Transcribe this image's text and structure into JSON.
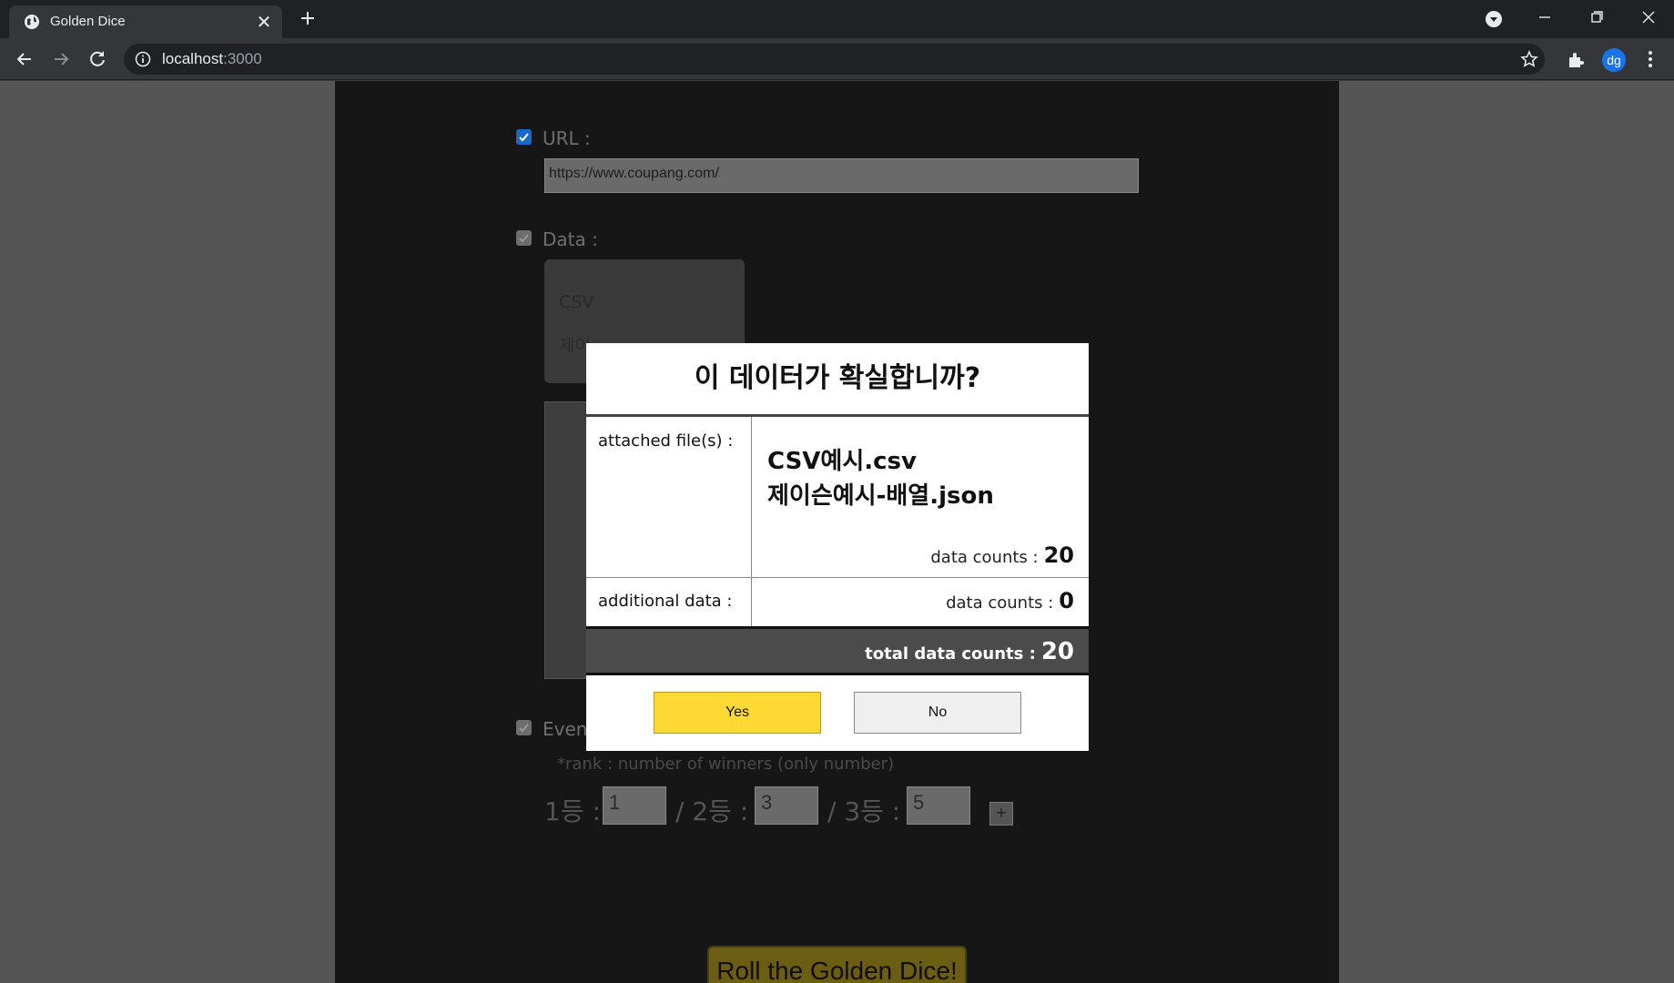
{
  "browser": {
    "tab_title": "Golden Dice",
    "tab_close": "✕",
    "url_host": "localhost",
    "url_port": ":3000",
    "profile_initials": "dg"
  },
  "form": {
    "url_label": "URL :",
    "url_value": "https://www.coupang.com/",
    "data_label": "Data :",
    "data_file1_partial": "CSV",
    "data_file2_partial": "제이",
    "event_label": "Event :",
    "event_hint": "*rank : number of winners (only number)",
    "rank1_label": "1등 :",
    "rank1_value": "1",
    "rank2_label": "/ 2등 :",
    "rank2_value": "3",
    "rank3_label": "/ 3등 :",
    "rank3_value": "5",
    "add_rank_label": "+",
    "roll_button": "Roll the Golden Dice!"
  },
  "modal": {
    "title": "이 데이터가 확실합니까?",
    "attached_label": "attached file(s) :",
    "file1": "CSV예시.csv",
    "file2": "제이슨예시-배열.json",
    "attached_count_label": "data counts :",
    "attached_count": "20",
    "additional_label": "additional data :",
    "additional_count_label": "data counts :",
    "additional_count": "0",
    "total_label": "total data counts :",
    "total_count": "20",
    "yes_label": "Yes",
    "no_label": "No"
  }
}
